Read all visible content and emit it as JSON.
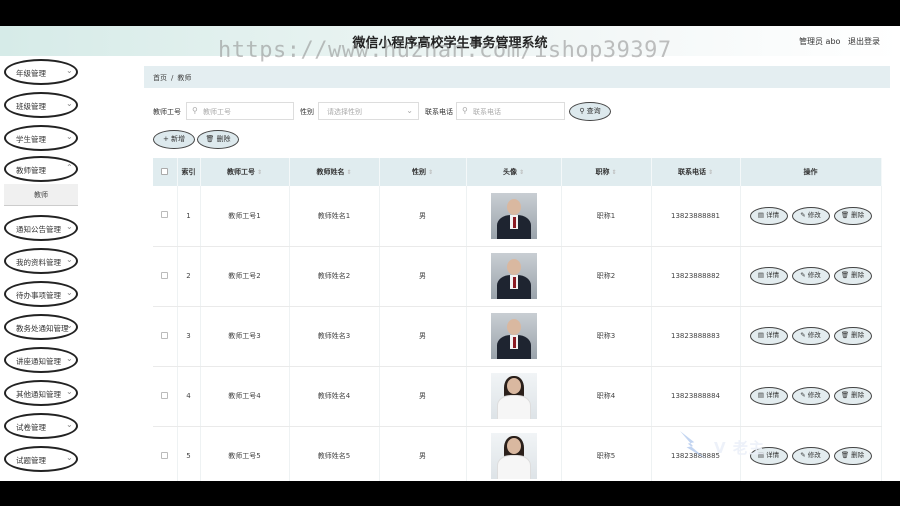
{
  "header": {
    "title": "微信小程序高校学生事务管理系统",
    "user_label": "管理员 abo",
    "logout_label": "退出登录"
  },
  "watermark": "https://www.huzhan.com/ishop39397",
  "sidebar": {
    "items": [
      {
        "label": "年级管理"
      },
      {
        "label": "班级管理"
      },
      {
        "label": "学生管理"
      },
      {
        "label": "教师管理"
      },
      {
        "label": "通知公告管理"
      },
      {
        "label": "我的资料管理"
      },
      {
        "label": "待办事项管理"
      },
      {
        "label": "教务处通知管理"
      },
      {
        "label": "讲座通知管理"
      },
      {
        "label": "其他通知管理"
      },
      {
        "label": "试卷管理"
      },
      {
        "label": "试题管理"
      }
    ],
    "submenu_label": "教师"
  },
  "breadcrumb": {
    "home": "首页",
    "separator": "/",
    "current": "教师"
  },
  "filters": {
    "teacher_no_label": "教师工号",
    "teacher_no_placeholder": "教师工号",
    "gender_label": "性别",
    "gender_placeholder": "请选择性别",
    "phone_label": "联系电话",
    "phone_placeholder": "联系电话",
    "query_label": "查询"
  },
  "actions": {
    "add_label": "+ 新增",
    "delete_label": "删除"
  },
  "table": {
    "columns": [
      "索引",
      "教师工号",
      "教师姓名",
      "性别",
      "头像",
      "职称",
      "联系电话",
      "操作"
    ],
    "rows": [
      {
        "index": "1",
        "teacher_no": "教师工号1",
        "name": "教师姓名1",
        "gender": "男",
        "avatar": "male",
        "title": "职称1",
        "phone": "13823888881"
      },
      {
        "index": "2",
        "teacher_no": "教师工号2",
        "name": "教师姓名2",
        "gender": "男",
        "avatar": "male2",
        "title": "职称2",
        "phone": "13823888882"
      },
      {
        "index": "3",
        "teacher_no": "教师工号3",
        "name": "教师姓名3",
        "gender": "男",
        "avatar": "male",
        "title": "职称3",
        "phone": "13823888883"
      },
      {
        "index": "4",
        "teacher_no": "教师工号4",
        "name": "教师姓名4",
        "gender": "男",
        "avatar": "female",
        "title": "职称4",
        "phone": "13823888884"
      },
      {
        "index": "5",
        "teacher_no": "教师工号5",
        "name": "教师姓名5",
        "gender": "男",
        "avatar": "female",
        "title": "职称5",
        "phone": "13823888885"
      }
    ],
    "row_actions": {
      "detail": "详情",
      "edit": "修改",
      "delete": "删除"
    }
  },
  "logo_watermark": "V 老主"
}
